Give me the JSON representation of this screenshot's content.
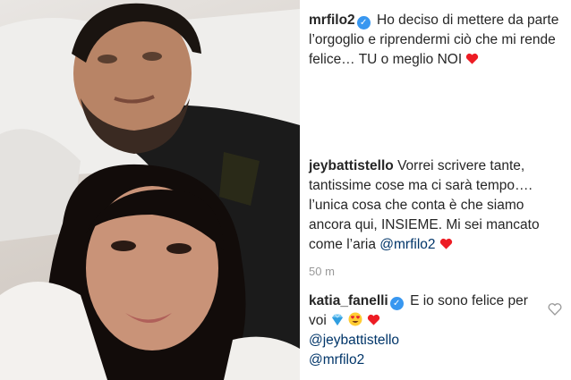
{
  "post": {
    "username": "mrfilo2",
    "caption": "Ho deciso di mettere da parte l’orgoglio e riprendermi ciò che mi rende felice… TU o meglio NOI",
    "emoji": "red-heart-emoji"
  },
  "comments": [
    {
      "username": "jeybattistello",
      "text": "Vorrei scrivere tante, tantissime cose ma ci sarà tempo…. l’unica cosa che conta è che siamo ancora qui, INSIEME. Mi sei mancato come l’aria",
      "mention": "@mrfilo2",
      "emoji": "red-heart-emoji",
      "time": "50 m"
    },
    {
      "username": "katia_fanelli",
      "text": "E io sono felice per voi",
      "emojis": [
        "blue-diamond-emoji",
        "heart-eyes-emoji",
        "red-heart-emoji"
      ],
      "mentions": [
        "@jeybattistello",
        "@mrfilo2"
      ]
    }
  ],
  "colors": {
    "verified": "#3897f0",
    "mention": "#003569",
    "heart": "#ed1c24",
    "muted": "#999999"
  }
}
